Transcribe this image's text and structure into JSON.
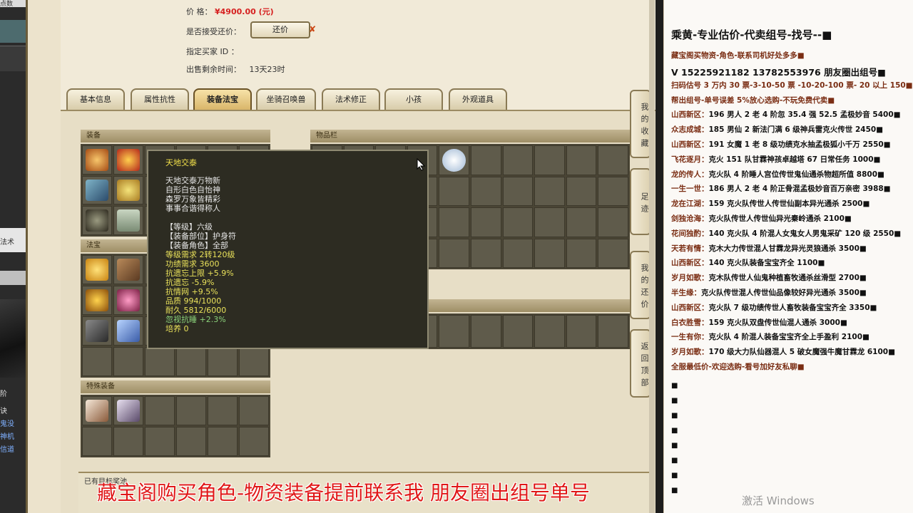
{
  "left_strip": {
    "items": [
      "点数",
      "法术",
      "阶",
      "诀",
      "鬼没",
      "神机",
      "信道"
    ]
  },
  "listing": {
    "price_label": "价        格：",
    "price_value": "¥4900.00 (元)",
    "bargain_label": "是否接受还价：",
    "bargain_button": "还价",
    "bargain_x": "✘",
    "buyer_label": "指定买家 ID ：",
    "time_label": "出售剩余时间：",
    "time_value": "13天23时"
  },
  "tabs": [
    {
      "label": "基本信息",
      "active": false
    },
    {
      "label": "属性抗性",
      "active": false
    },
    {
      "label": "装备法宝",
      "active": true
    },
    {
      "label": "坐骑召唤兽",
      "active": false
    },
    {
      "label": "法术修正",
      "active": false
    },
    {
      "label": "小孩",
      "active": false
    },
    {
      "label": "外观道具",
      "active": false
    }
  ],
  "sections": {
    "equipment": "装备",
    "fabao": "法宝",
    "item_bar": "物品栏",
    "special": "特殊装备",
    "bottom": "已有目标奖池"
  },
  "tooltip": {
    "title": "天地交泰",
    "poem": [
      "天地交泰万物新",
      "自形白色自怡神",
      "森罗万象皆精彩",
      "事事合谐得称人"
    ],
    "level": "【等级】六级",
    "slot": "【装备部位】护身符",
    "role": "【装备角色】全部",
    "stats": [
      "等级需求 2转120级",
      "功绩需求 3600",
      "抗遗忘上限 +5.9%",
      "抗遗忘 -5.9%",
      "抗情网 +9.5%",
      "品质 994/1000",
      "耐久 5812/6000"
    ],
    "green_stat": "忽视抗睡 +2.3%",
    "cultivate": "培养 0"
  },
  "side_buttons": [
    "我的收藏",
    "足迹",
    "我的还价",
    "返回顶部"
  ],
  "right_panel": {
    "title": "乘黄-专业估价-代卖组号-找号--■",
    "lines": [
      {
        "text": "藏宝阁买物资-角色-联系司机好处多多■",
        "cls": "red"
      },
      {
        "text": "V 15225921182   13782553976 朋友圈出组号■",
        "cls": "big"
      },
      {
        "text": "扫码估号 3 万内 30 票-3-10-50 票  -10-20-100 票- 20 以上 150■",
        "cls": "red"
      },
      {
        "text": "帮出组号-单号误差 5%放心选购-不玩免费代卖■",
        "cls": "red"
      },
      {
        "name": "山西新区：",
        "text": "196 男人 2 老 4 阶忽 35.4 强 52.5 孟极妙音 5400■"
      },
      {
        "name": "众志成城：",
        "text": "185 男仙 2 新法门满 6 级神兵雷克火传世 2450■"
      },
      {
        "name": "山西新区：",
        "text": "191 女魔 1 老 8 级功绩克水抽孟极狐小千万 2550■"
      },
      {
        "name": "飞花逐月：",
        "text": "克火 151 队甘霖神孩卓越塔 67 日常任务 1000■"
      },
      {
        "name": "龙的传人：",
        "text": "克火队 4 阶睡人宫位传世鬼仙通杀物超所值 8800■"
      },
      {
        "name": "一生一世：",
        "text": "186 男人 2 老 4 阶正骨混孟极妙音百万亲密 3988■"
      },
      {
        "name": "龙在江湖：",
        "text": "159 克火队传世人传世仙副本异光通杀 2500■"
      },
      {
        "name": "剑独沧海：",
        "text": "克火队传世人传世仙异光秦岭通杀 2100■"
      },
      {
        "name": "花间独酌：",
        "text": "140 克火队 4 阶混人女鬼女人男鬼采矿 120 级 2550■"
      },
      {
        "name": "天若有情：",
        "text": "克木大力传世混人甘霖龙异光灵狼通杀 3500■"
      },
      {
        "name": "山西新区：",
        "text": "140 克火队装备宝宝齐全 1100■"
      },
      {
        "name": "岁月如歌：",
        "text": "克木队传世人仙鬼种植畜牧通杀丝滑型 2700■"
      },
      {
        "name": "半生缘：",
        "text": "克火队传世混人传世仙品像较好异光通杀 3500■"
      },
      {
        "name": "山西新区：",
        "text": "克火队 7 级功绩传世人畜牧装备宝宝齐全 3350■"
      },
      {
        "name": "白衣胜雪：",
        "text": "159 克火队双盘传世仙混人通杀 3000■"
      },
      {
        "name": "一生有你：",
        "text": "克火队 4 阶混人装备宝宝齐全上手盈利 2100■"
      },
      {
        "name": "岁月如歌：",
        "text": "170 级大力队仙器混人 5 破女魔强牛魔甘霖龙 6100■"
      },
      {
        "text": "全服最低价-欢迎选购-看号加好友私聊■",
        "cls": "red"
      }
    ],
    "bullet": "■"
  },
  "caption": "藏宝阁购买角色-物资装备提前联系我      朋友圈出组号单号",
  "watermark": "激活 Windows"
}
